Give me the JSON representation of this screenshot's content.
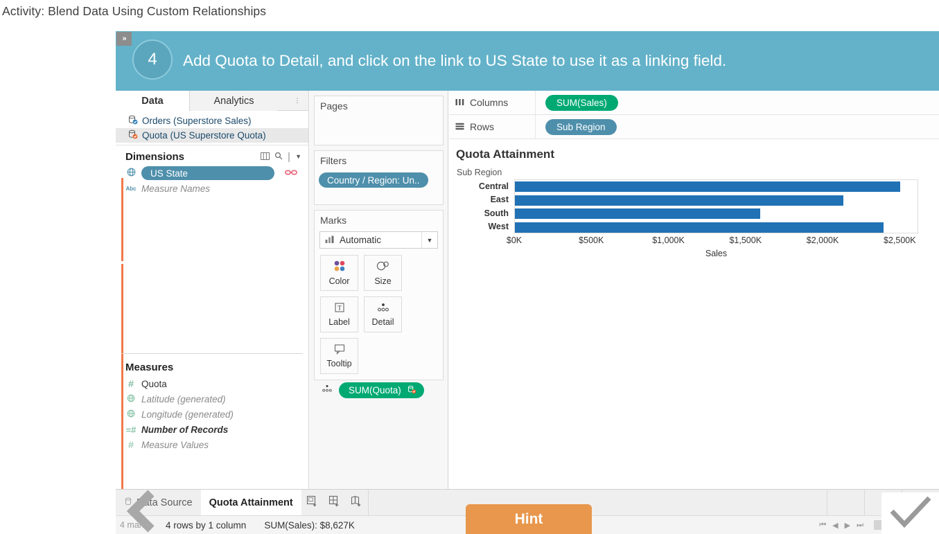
{
  "page": {
    "title": "Activity: Blend Data Using Custom Relationships"
  },
  "banner": {
    "expand_label": "»",
    "step_number": "4",
    "instruction": "Add Quota to Detail, and click on the link to US State to use it as a linking field."
  },
  "data_pane": {
    "tabs": [
      {
        "label": "Data",
        "active": true
      },
      {
        "label": "Analytics",
        "active": false
      }
    ],
    "data_sources": [
      {
        "label": "Orders (Superstore Sales)",
        "selected": false
      },
      {
        "label": "Quota (US Superstore Quota)",
        "selected": true
      }
    ],
    "dimensions": {
      "header": "Dimensions",
      "fields": [
        {
          "label": "US State",
          "icon": "globe-icon",
          "style": "pill",
          "linked": true
        },
        {
          "label": "Measure Names",
          "icon": "abc-icon",
          "style": "italic"
        }
      ]
    },
    "measures": {
      "header": "Measures",
      "fields": [
        {
          "label": "Quota",
          "icon": "number-icon",
          "style": "normal"
        },
        {
          "label": "Latitude (generated)",
          "icon": "geo-icon",
          "style": "italic"
        },
        {
          "label": "Longitude (generated)",
          "icon": "geo-icon",
          "style": "italic"
        },
        {
          "label": "Number of Records",
          "icon": "calc-number-icon",
          "style": "italic-dark"
        },
        {
          "label": "Measure Values",
          "icon": "number-icon",
          "style": "italic"
        }
      ]
    }
  },
  "shelves": {
    "pages": {
      "title": "Pages"
    },
    "filters": {
      "title": "Filters",
      "pills": [
        "Country / Region: Un.."
      ]
    },
    "marks": {
      "title": "Marks",
      "mark_type": "Automatic",
      "buttons": [
        {
          "label": "Color",
          "icon": "color-dots-icon"
        },
        {
          "label": "Size",
          "icon": "size-circles-icon"
        },
        {
          "label": "Label",
          "icon": "label-text-icon"
        },
        {
          "label": "Detail",
          "icon": "detail-dots-icon"
        },
        {
          "label": "Tooltip",
          "icon": "tooltip-bubble-icon"
        }
      ],
      "pills": [
        {
          "label": "SUM(Quota)",
          "icon": "detail-dots-icon",
          "badge": "data-source-icon"
        }
      ]
    },
    "columns": {
      "label": "Columns",
      "icon": "columns-icon",
      "pill": "SUM(Sales)"
    },
    "rows": {
      "label": "Rows",
      "icon": "rows-icon",
      "pill": "Sub Region"
    }
  },
  "chart_data": {
    "type": "bar",
    "title": "Quota Attainment",
    "orientation": "horizontal",
    "row_header": "Sub Region",
    "categories": [
      "Central",
      "East",
      "South",
      "West"
    ],
    "values": [
      2500,
      2130,
      1590,
      2390
    ],
    "value_unit": "thousands of dollars",
    "xlabel": "Sales",
    "ylabel": "Sub Region",
    "xlim": [
      0,
      2620
    ],
    "xticks": [
      0,
      500,
      1000,
      1500,
      2000,
      2500
    ],
    "xtick_labels": [
      "$0K",
      "$500K",
      "$1,000K",
      "$1,500K",
      "$2,000K",
      "$2,500K"
    ],
    "bar_color": "#2171b5",
    "grid": false,
    "legend": "none"
  },
  "worksheet_tabs": {
    "tabs": [
      {
        "label": "Data Source",
        "icon": "data-source-icon",
        "active": false
      },
      {
        "label": "Quota Attainment",
        "icon": "",
        "active": true
      }
    ],
    "new_buttons": [
      {
        "name": "new-worksheet",
        "icon": "new-worksheet-icon"
      },
      {
        "name": "new-dashboard",
        "icon": "new-dashboard-icon"
      },
      {
        "name": "new-story",
        "icon": "new-story-icon"
      }
    ]
  },
  "statusbar": {
    "marks": "4 marks",
    "rows_cols": "4 rows by 1 column",
    "aggregate": "SUM(Sales): $8,627K"
  },
  "overlays": {
    "hint_label": "Hint",
    "back_icon": "back-chevron-icon",
    "confirm_icon": "checkmark-icon"
  },
  "colors": {
    "banner": "#63b2c9",
    "bar": "#2171b5",
    "measure_pill": "#00a972",
    "dimension_pill": "#4e8fab",
    "hint": "#e8974c",
    "accent": "#f2784b"
  }
}
